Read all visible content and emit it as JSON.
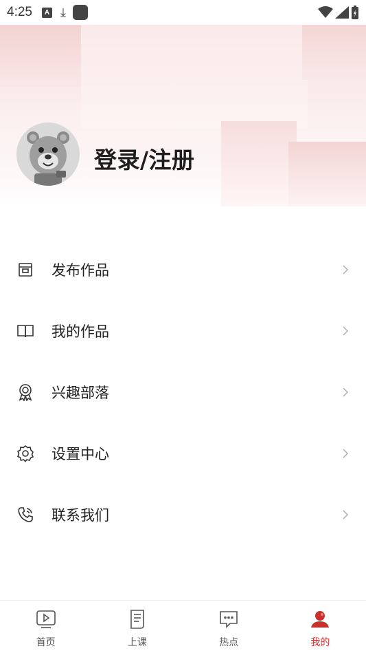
{
  "status_bar": {
    "time": "4:25",
    "a_badge": "A",
    "download_glyph": "⤓"
  },
  "header": {
    "login_label": "登录/注册"
  },
  "menu": {
    "items": [
      {
        "label": "发布作品",
        "icon": "publish-icon"
      },
      {
        "label": "我的作品",
        "icon": "book-icon"
      },
      {
        "label": "兴趣部落",
        "icon": "badge-icon"
      },
      {
        "label": "设置中心",
        "icon": "gear-icon"
      },
      {
        "label": "联系我们",
        "icon": "phone-icon"
      }
    ]
  },
  "tabbar": {
    "tabs": [
      {
        "label": "首页",
        "icon": "play-icon",
        "active": false
      },
      {
        "label": "上课",
        "icon": "document-icon",
        "active": false
      },
      {
        "label": "热点",
        "icon": "chat-icon",
        "active": false
      },
      {
        "label": "我的",
        "icon": "user-icon",
        "active": true
      }
    ]
  },
  "colors": {
    "accent": "#c9302c",
    "header_gradient_top": "#f7dede",
    "text": "#222222",
    "muted": "#555555"
  }
}
